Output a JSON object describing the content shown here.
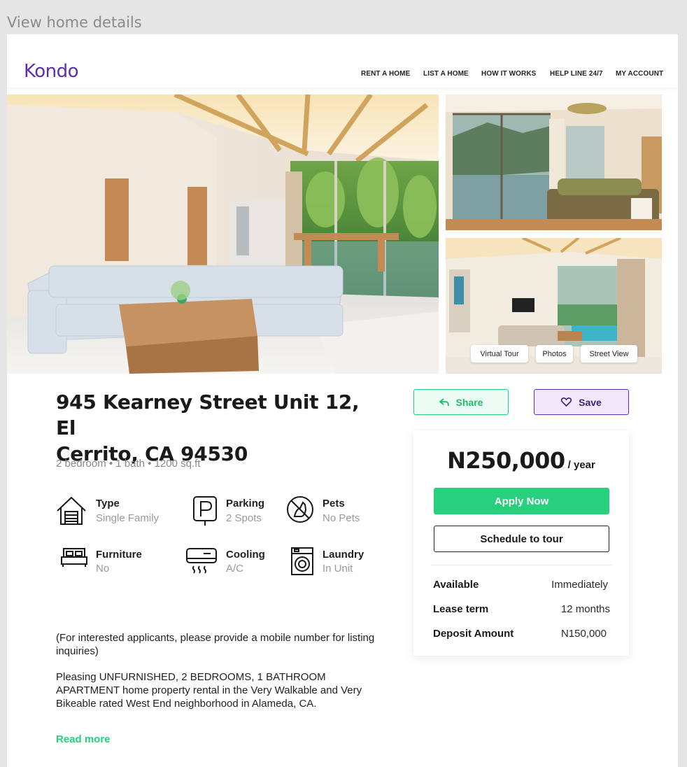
{
  "frame_title": "View home details",
  "header": {
    "logo": "Kondo",
    "nav": [
      "RENT A HOME",
      "LIST A HOME",
      "HOW IT WORKS",
      "HELP LINE 24/7",
      "MY ACCOUNT"
    ]
  },
  "gallery": {
    "buttons": [
      "Virtual Tour",
      "Photos",
      "Street View"
    ]
  },
  "listing": {
    "address_line1": "945 Kearney Street Unit 12, El",
    "address_line2": "Cerrito, CA 94530",
    "summary": "2 bedroom • 1 bath • 1200 sq.ft",
    "features": [
      {
        "label": "Type",
        "value": "Single Family",
        "icon": "house-garage-icon"
      },
      {
        "label": "Parking",
        "value": "2 Spots",
        "icon": "parking-icon"
      },
      {
        "label": "Pets",
        "value": "No Pets",
        "icon": "no-pets-icon"
      },
      {
        "label": "Furniture",
        "value": "No",
        "icon": "bed-icon"
      },
      {
        "label": "Cooling",
        "value": "A/C",
        "icon": "air-conditioner-icon"
      },
      {
        "label": "Laundry",
        "value": "In Unit",
        "icon": "washing-machine-icon"
      }
    ],
    "note": "(For interested applicants, please provide a mobile number for listing inquiries)",
    "description": "Pleasing UNFURNISHED, 2 BEDROOMS, 1 BATHROOM APARTMENT home property rental in the Very Walkable and Very Bikeable rated West End neighborhood in Alameda, CA.",
    "read_more": "Read more"
  },
  "actions": {
    "share": "Share",
    "save": "Save"
  },
  "pricing": {
    "amount": "N250,000",
    "unit": "/ year",
    "apply": "Apply Now",
    "tour": "Schedule to tour",
    "terms": [
      {
        "label": "Available",
        "value": "Immediately"
      },
      {
        "label": "Lease term",
        "value": "12 months"
      },
      {
        "label": "Deposit Amount",
        "value": "N150,000"
      }
    ]
  },
  "colors": {
    "brand": "#5b2fb4",
    "accent": "#26d07c"
  }
}
